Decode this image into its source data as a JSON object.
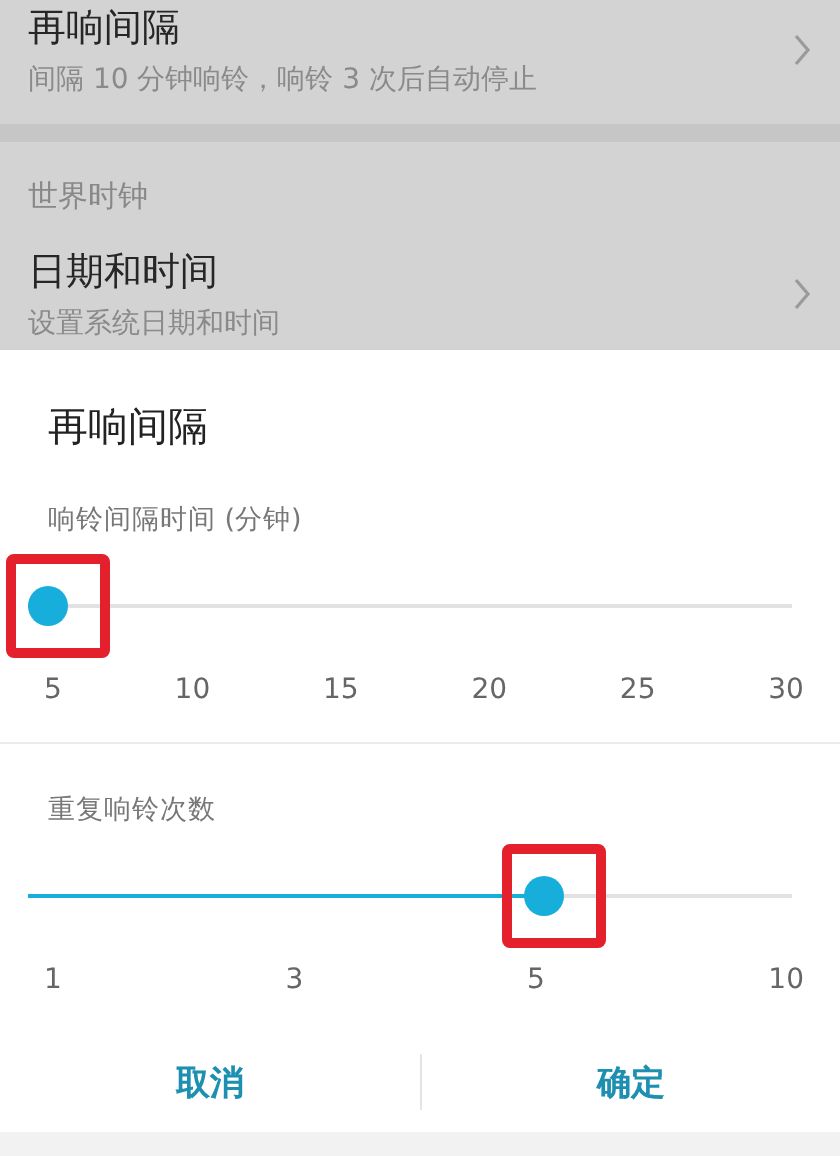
{
  "settings": [
    {
      "kind": "item",
      "title": "再响间隔",
      "subtitle": "间隔 10 分钟响铃，响铃 3 次后自动停止"
    },
    {
      "kind": "gap"
    },
    {
      "kind": "header",
      "title": "世界时钟"
    },
    {
      "kind": "item",
      "title": "日期和时间",
      "subtitle": "设置系统日期和时间"
    }
  ],
  "dialog": {
    "title": "再响间隔",
    "sliders": [
      {
        "label": "响铃间隔时间 (分钟)",
        "level": 0,
        "highlighted": true,
        "ticks": [
          "5",
          "10",
          "15",
          "20",
          "25",
          "30"
        ]
      },
      {
        "label": "重复响铃次数",
        "level": 0.667,
        "highlighted": true,
        "ticks": [
          "1",
          "3",
          "5",
          "10"
        ]
      }
    ],
    "buttons": [
      "取消",
      "确定"
    ]
  }
}
